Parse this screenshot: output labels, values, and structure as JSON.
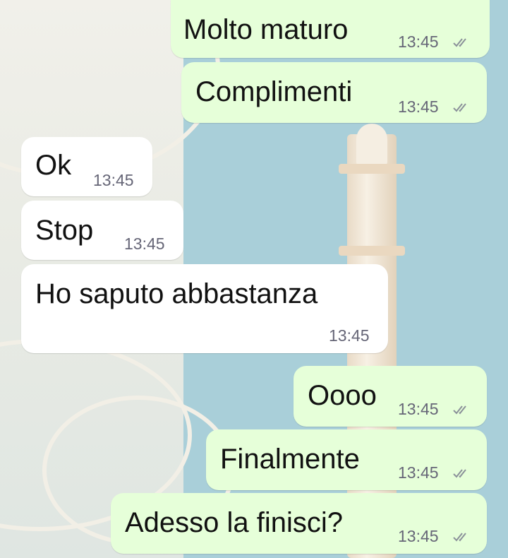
{
  "messages": [
    {
      "text": "Molto maturo",
      "time": "13:45",
      "direction": "outgoing",
      "status": "read"
    },
    {
      "text": "Complimenti",
      "time": "13:45",
      "direction": "outgoing",
      "status": "read"
    },
    {
      "text": "Ok",
      "time": "13:45",
      "direction": "incoming"
    },
    {
      "text": "Stop",
      "time": "13:45",
      "direction": "incoming"
    },
    {
      "text": "Ho saputo abbastanza",
      "time": "13:45",
      "direction": "incoming"
    },
    {
      "text": "Oooo",
      "time": "13:45",
      "direction": "outgoing",
      "status": "read"
    },
    {
      "text": "Finalmente",
      "time": "13:45",
      "direction": "outgoing",
      "status": "read"
    },
    {
      "text": "Adesso la finisci?",
      "time": "13:45",
      "direction": "outgoing",
      "status": "read"
    }
  ],
  "colors": {
    "outgoing_bubble": "#e6ffd9",
    "incoming_bubble": "#ffffff",
    "tick_color": "#8a9099",
    "wallpaper_sky": "#a9cfd9"
  },
  "icons": {
    "status": "double-check-icon"
  }
}
